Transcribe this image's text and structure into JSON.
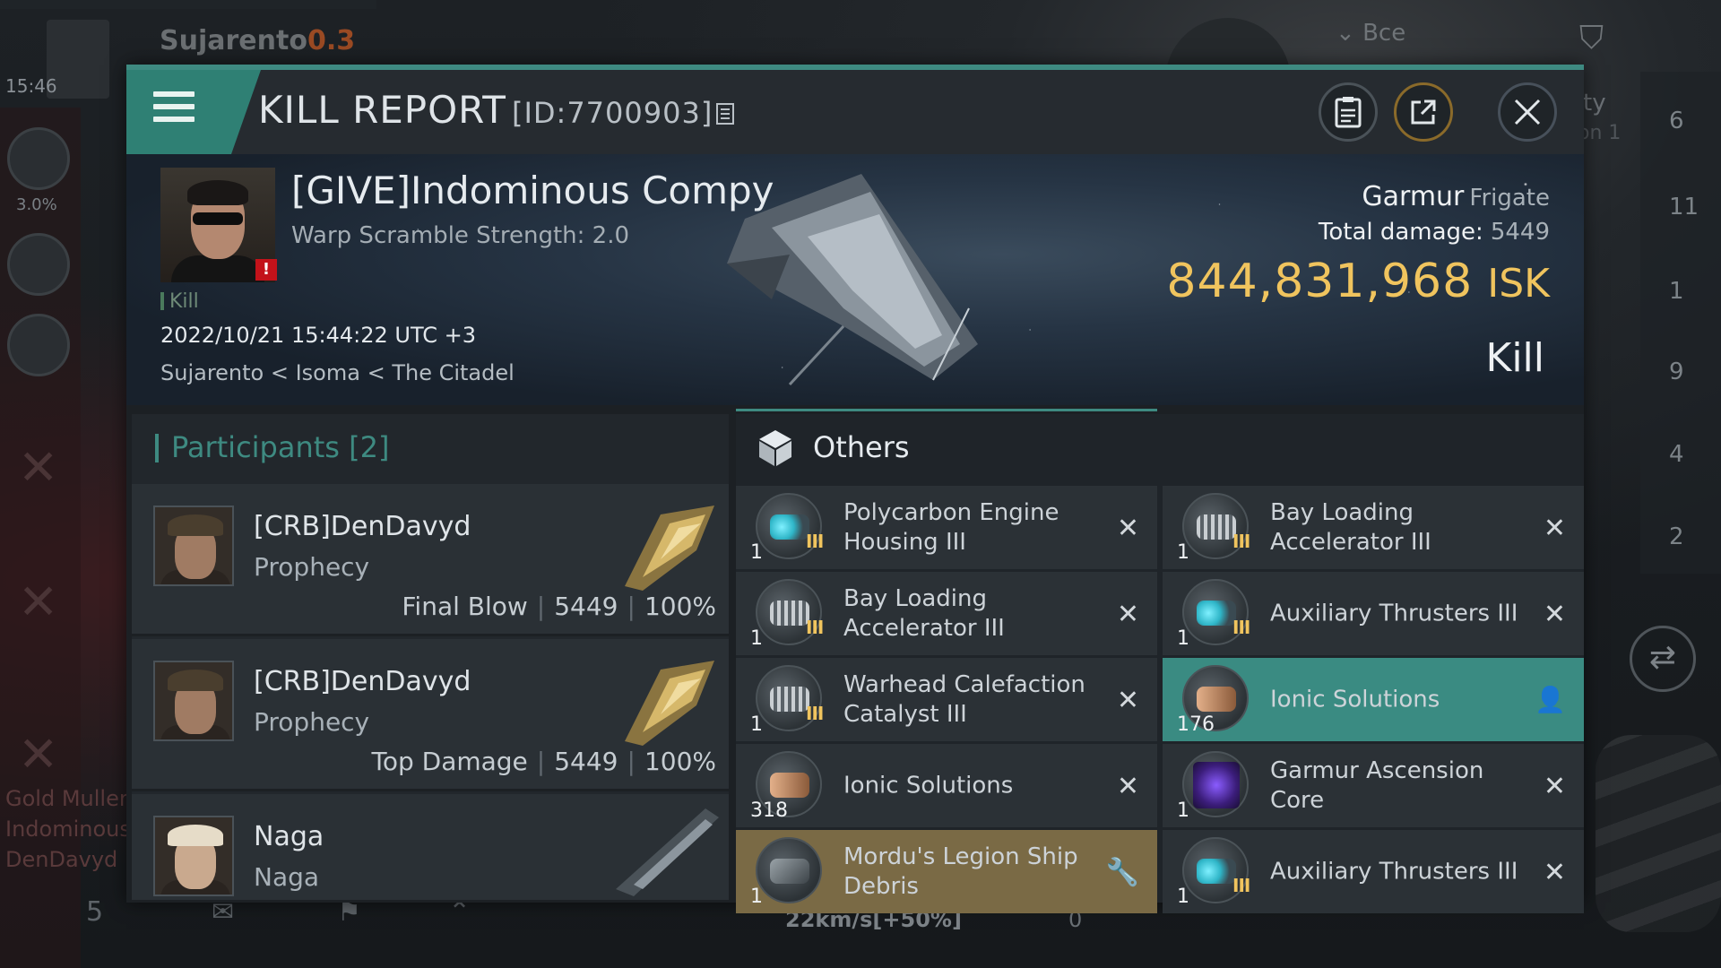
{
  "background": {
    "system_name": "Sujarento",
    "system_security": "0.3",
    "clock": "15:46",
    "left_pct": "3.0%",
    "filter_label": "Все",
    "right_partial_1": "ty",
    "right_partial_2": "on 1",
    "right_counts": [
      "6",
      "11",
      "1",
      "9",
      "4",
      "2"
    ],
    "feed_lines": [
      "Gold Muller",
      "Indominous",
      "DenDavyd :"
    ],
    "speed": "22km/s[+50%]",
    "zero": "0",
    "left_bottom_count": "5"
  },
  "window": {
    "title": "KILL REPORT",
    "report_id": "[ID:7700903]",
    "buttons": {
      "notes_icon": "clipboard-icon",
      "share_icon": "share-icon",
      "close_icon": "close-icon"
    }
  },
  "victim": {
    "name": "[GIVE]Indominous Compy",
    "subtitle": "Warp Scramble Strength: 2.0",
    "tag": "Kill",
    "time": "2022/10/21 15:44:22 UTC +3",
    "location": "Sujarento < Isoma < The Citadel",
    "ship_name": "Garmur",
    "ship_class": "Frigate",
    "total_damage_label": "Total damage:",
    "total_damage": "5449",
    "isk_value": "844,831,968",
    "isk_unit": "ISK",
    "kill_type": "Kill"
  },
  "participants": {
    "title": "Participants",
    "count": "[2]",
    "rows": [
      {
        "name": "[CRB]DenDavyd",
        "ship": "Prophecy",
        "role": "Final Blow",
        "damage": "5449",
        "pct": "100%"
      },
      {
        "name": "[CRB]DenDavyd",
        "ship": "Prophecy",
        "role": "Top Damage",
        "damage": "5449",
        "pct": "100%"
      },
      {
        "name": "Naga",
        "ship": "Naga",
        "role": "",
        "damage": "",
        "pct": ""
      }
    ]
  },
  "items": {
    "tab_label": "Others",
    "left": [
      {
        "name": "Polycarbon Engine Housing III",
        "qty": "1",
        "tier": "III",
        "icon": "cyan",
        "action": "✕"
      },
      {
        "name": "Bay Loading Accelerator III",
        "qty": "1",
        "tier": "III",
        "icon": "grey",
        "action": "✕"
      },
      {
        "name": "Warhead Calefaction Catalyst III",
        "qty": "1",
        "tier": "III",
        "icon": "grey",
        "action": "✕"
      },
      {
        "name": "Ionic Solutions",
        "qty": "318",
        "tier": "",
        "icon": "copper",
        "action": "✕"
      },
      {
        "name": "Mordu's Legion Ship Debris",
        "qty": "1",
        "tier": "",
        "icon": "debris",
        "action": "🔧"
      }
    ],
    "right": [
      {
        "name": "Bay Loading Accelerator III",
        "qty": "1",
        "tier": "III",
        "icon": "grey",
        "action": "✕"
      },
      {
        "name": "Auxiliary Thrusters III",
        "qty": "1",
        "tier": "III",
        "icon": "cyan",
        "action": "✕"
      },
      {
        "name": "Ionic Solutions",
        "qty": "176",
        "tier": "",
        "icon": "copper",
        "action": "👤"
      },
      {
        "name": "Garmur Ascension Core",
        "qty": "1",
        "tier": "",
        "icon": "purple",
        "action": "✕"
      },
      {
        "name": "Auxiliary Thrusters III",
        "qty": "1",
        "tier": "III",
        "icon": "cyan",
        "action": "✕"
      }
    ]
  }
}
